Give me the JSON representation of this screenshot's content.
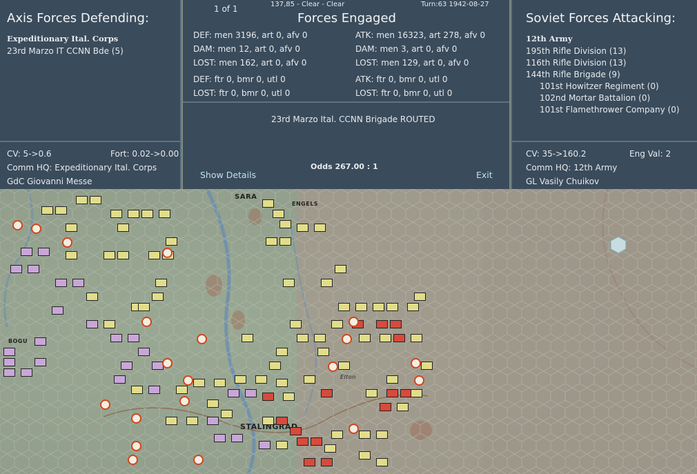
{
  "axis": {
    "title": "Axis Forces Defending:",
    "commander_unit": "Expeditionary Ital. Corps",
    "units": [
      "23rd Marzo IT CCNN Bde (5)"
    ],
    "cv": "CV: 5->0.6",
    "fort": "Fort: 0.02->0.00",
    "hq": "Comm HQ: Expeditionary Ital. Corps",
    "leader": "GdC Giovanni Messe"
  },
  "center": {
    "page": "1 of 1",
    "coords_weather": "137,85 - Clear - Clear",
    "turn": "Turn:63  1942-08-27",
    "title": "Forces Engaged",
    "def_lines": [
      "DEF: men 3196, art 0, afv 0",
      "DAM: men 12, art 0, afv 0",
      "LOST: men 162, art 0, afv 0"
    ],
    "atk_lines": [
      "ATK: men 16323, art 278, afv 0",
      "DAM: men 3, art 0, afv 0",
      "LOST: men 129, art 0, afv 0"
    ],
    "def_air": [
      "DEF: ftr 0, bmr 0, utl 0",
      "LOST: ftr 0, bmr 0, utl 0"
    ],
    "atk_air": [
      "ATK: ftr 0, bmr 0, utl 0",
      "LOST: ftr 0, bmr 0, utl 0"
    ],
    "result": "23rd Marzo Ital. CCNN Brigade ROUTED",
    "odds": "Odds 267.00 : 1",
    "show_details": "Show Details",
    "exit": "Exit"
  },
  "soviet": {
    "title": "Soviet Forces Attacking:",
    "commander_unit": "12th Army",
    "units": [
      "195th Rifle Division (13)",
      "116th Rifle Division (13)",
      "144th Rifle Brigade (9)"
    ],
    "subunits": [
      "101st Howitzer Regiment (0)",
      "102nd Mortar Battalion (0)",
      "101st Flamethrower Company (0)"
    ],
    "cv": "CV: 35->160.2",
    "eng": "Eng Val: 2",
    "hq": "Comm HQ: 12th Army",
    "leader": "GL Vasily Chuikov"
  },
  "map": {
    "labels": [
      "SARA",
      "ENGELS",
      "BOGU",
      "STALINGRAD",
      "Elton"
    ],
    "colors": {
      "axis_counter": "#e1dd8a",
      "german_counter": "#c9a6d8",
      "soviet_counter": "#d74a3c",
      "hex_line": "#b5b6ad"
    }
  }
}
